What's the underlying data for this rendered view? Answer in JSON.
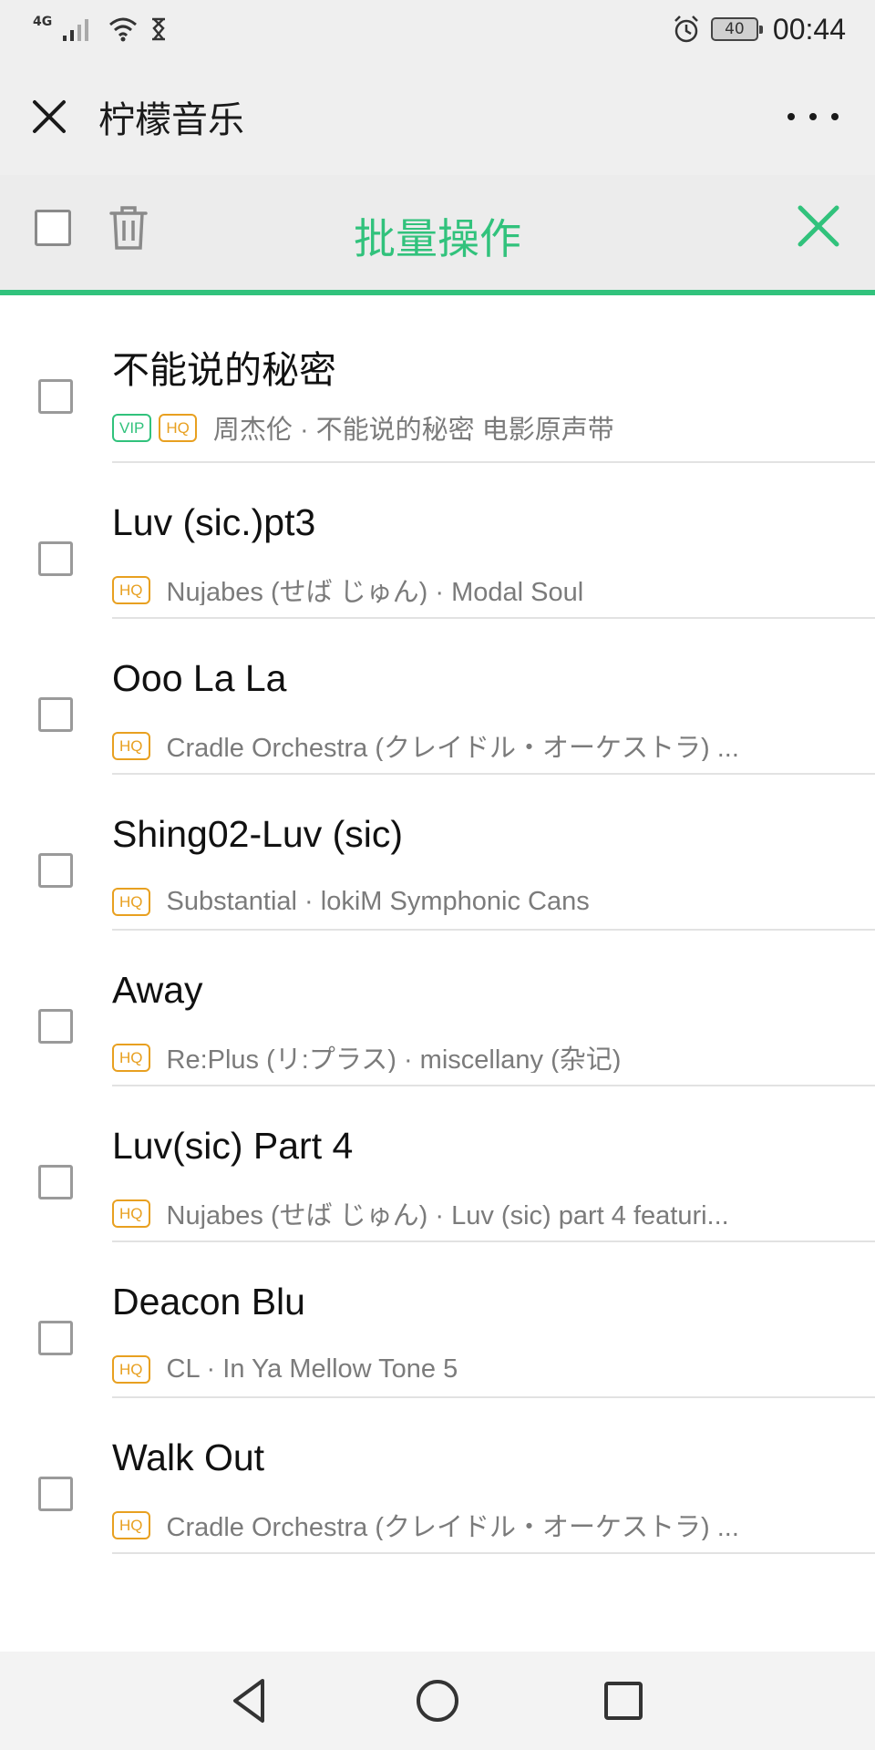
{
  "status_bar": {
    "network": "4G",
    "battery": "40",
    "time": "00:44",
    "icons": [
      "signal-icon",
      "wifi-icon",
      "hourglass-icon",
      "alarm-icon",
      "battery-icon"
    ]
  },
  "title_bar": {
    "title": "柠檬音乐",
    "close_icon": "close-icon",
    "more_icon": "more-icon"
  },
  "batch_bar": {
    "title": "批量操作",
    "accent": "#31c27c"
  },
  "songs": [
    {
      "title": "不能说的秘密",
      "vip": "VIP",
      "quality": "HQ",
      "meta": "周杰伦 · 不能说的秘密 电影原声带"
    },
    {
      "title": "Luv (sic.)pt3",
      "quality": "HQ",
      "meta": "Nujabes (せば じゅん) · Modal Soul"
    },
    {
      "title": "Ooo La La",
      "quality": "HQ",
      "meta": "Cradle Orchestra (クレイドル・オーケストラ) ..."
    },
    {
      "title": "Shing02-Luv (sic)",
      "quality": "HQ",
      "meta": "Substantial · lokiM Symphonic Cans"
    },
    {
      "title": "Away",
      "quality": "HQ",
      "meta": "Re:Plus (リ:プラス) · miscellany (杂记)"
    },
    {
      "title": "Luv(sic) Part 4",
      "quality": "HQ",
      "meta": "Nujabes (せば じゅん) · Luv (sic) part 4 featuri..."
    },
    {
      "title": "Deacon Blu",
      "quality": "HQ",
      "meta": "CL · In Ya Mellow Tone 5"
    },
    {
      "title": "Walk Out",
      "quality": "HQ",
      "meta": "Cradle Orchestra (クレイドル・オーケストラ) ..."
    }
  ],
  "colors": {
    "accent_green": "#31c27c",
    "hq_orange": "#e8a020",
    "meta_gray": "#7b7b7b"
  }
}
